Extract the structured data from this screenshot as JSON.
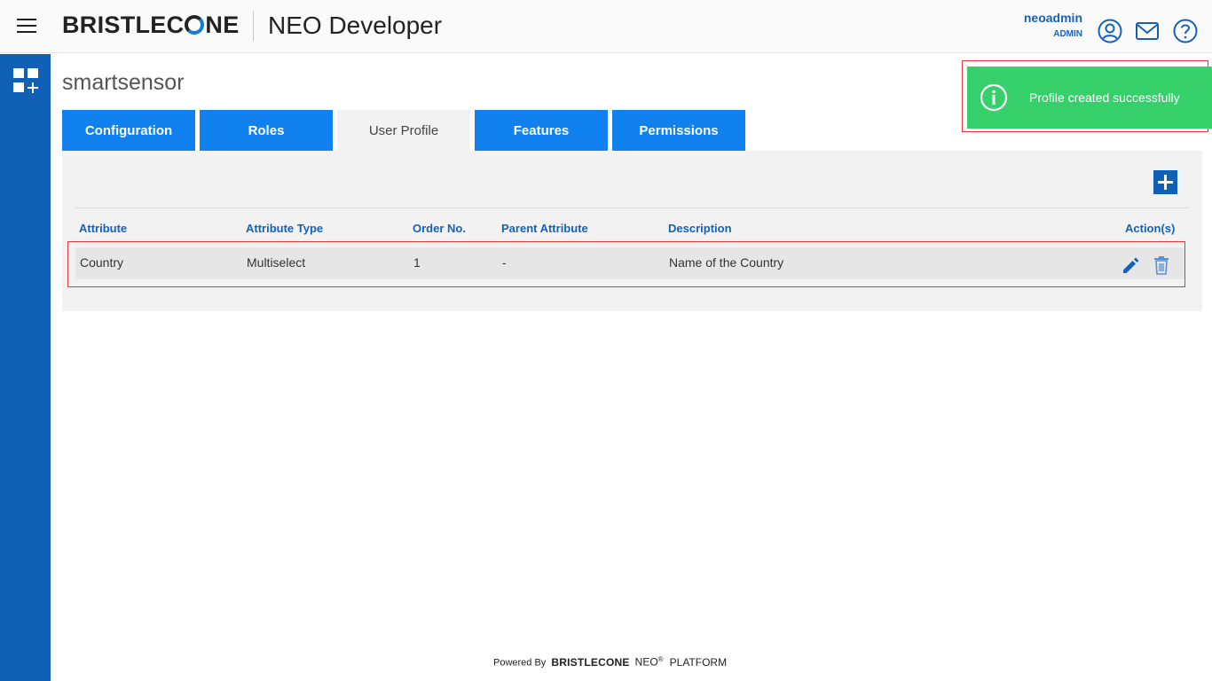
{
  "header": {
    "brand": {
      "before": "BRISTLEC",
      "after": "NE"
    },
    "app_title": "NEO Developer",
    "user_name": "neoadmin",
    "user_role": "ADMIN"
  },
  "page": {
    "title": "smartsensor"
  },
  "tabs": [
    {
      "label": "Configuration",
      "active": false
    },
    {
      "label": "Roles",
      "active": false
    },
    {
      "label": "User Profile",
      "active": true
    },
    {
      "label": "Features",
      "active": false
    },
    {
      "label": "Permissions",
      "active": false
    }
  ],
  "table": {
    "columns": [
      "Attribute",
      "Attribute Type",
      "Order No.",
      "Parent Attribute",
      "Description",
      "Action(s)"
    ],
    "rows": [
      {
        "attribute": "Country",
        "attribute_type": "Multiselect",
        "order_no": "1",
        "parent_attribute": "-",
        "description": "Name of the Country"
      }
    ]
  },
  "toast": {
    "message": "Profile created successfully",
    "color": "#36d06b"
  },
  "footer": {
    "powered_by": "Powered By",
    "brand": "BRISTLECONE",
    "neo": "NEO",
    "reg": "®",
    "platform": "PLATFORM"
  },
  "colors": {
    "primary": "#1061b5",
    "tab": "#1181ef",
    "link": "#1661b8"
  }
}
